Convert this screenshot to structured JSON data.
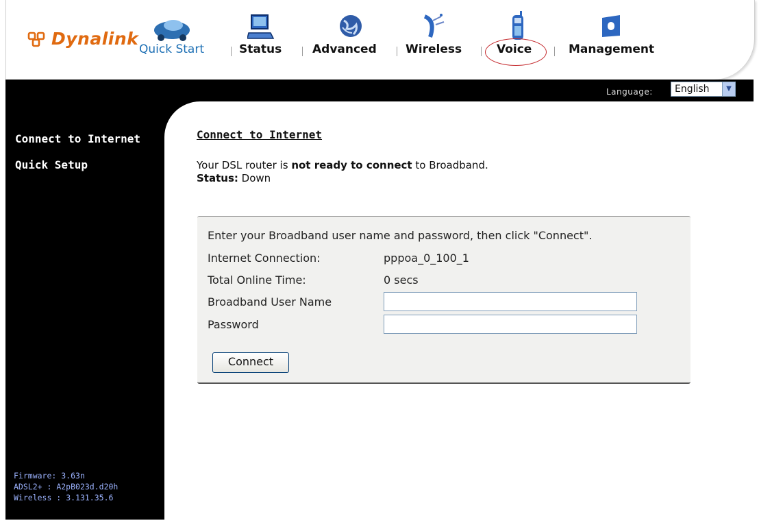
{
  "brand": {
    "name": "Dynalink"
  },
  "nav": {
    "quick_start": "Quick Start",
    "status": "Status",
    "advanced": "Advanced",
    "wireless": "Wireless",
    "voice": "Voice",
    "management": "Management"
  },
  "language": {
    "label": "Language:",
    "selected": "English"
  },
  "sidebar": {
    "items": [
      {
        "label": "Connect to Internet"
      },
      {
        "label": "Quick Setup"
      }
    ],
    "firmware": {
      "label": "Firmware:",
      "value": "3.63n"
    },
    "adsl": {
      "label": "ADSL2+ :",
      "value": "A2pB023d.d20h"
    },
    "wireless": {
      "label": "Wireless :",
      "value": "3.131.35.6"
    }
  },
  "main": {
    "title": "Connect to Internet",
    "status_pre": "Your DSL router is ",
    "status_bold": "not ready to connect",
    "status_post": " to Broadband.",
    "status_label": "Status:",
    "status_value": "Down"
  },
  "panel": {
    "instruction": "Enter your Broadband user name and password, then click \"Connect\".",
    "internet_connection_label": "Internet Connection:",
    "internet_connection_value": "pppoa_0_100_1",
    "online_time_label": "Total Online Time:",
    "online_time_value": "0 secs",
    "username_label": "Broadband User Name",
    "username_value": "",
    "password_label": "Password",
    "password_value": "",
    "connect_button": "Connect"
  },
  "colors": {
    "brand_orange": "#e06a10",
    "quick_start_blue": "#1c6fb4",
    "highlight_red": "#c4282c",
    "firmware_text": "#9cb3ff"
  },
  "icons": {
    "quick_start": "car-icon",
    "status": "monitor-icon",
    "advanced": "globe-icon",
    "wireless": "satellite-dish-icon",
    "voice": "phone-icon",
    "management": "folder-icon"
  }
}
